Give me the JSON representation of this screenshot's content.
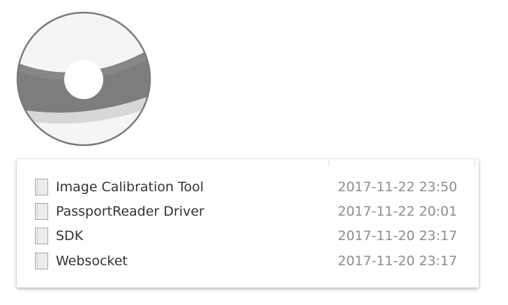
{
  "disc": {
    "icon": "cd-disc-icon",
    "colors": {
      "ring": "#777777",
      "band": "#7d7d7d",
      "surface": "#f5f5f5"
    }
  },
  "files": [
    {
      "icon": "folder-icon",
      "name": "Image Calibration Tool",
      "modified": "2017-11-22 23:50"
    },
    {
      "icon": "folder-icon",
      "name": "PassportReader Driver",
      "modified": "2017-11-22 20:01"
    },
    {
      "icon": "folder-icon",
      "name": "SDK",
      "modified": "2017-11-20 23:17"
    },
    {
      "icon": "folder-icon",
      "name": "Websocket",
      "modified": "2017-11-20 23:17"
    }
  ]
}
